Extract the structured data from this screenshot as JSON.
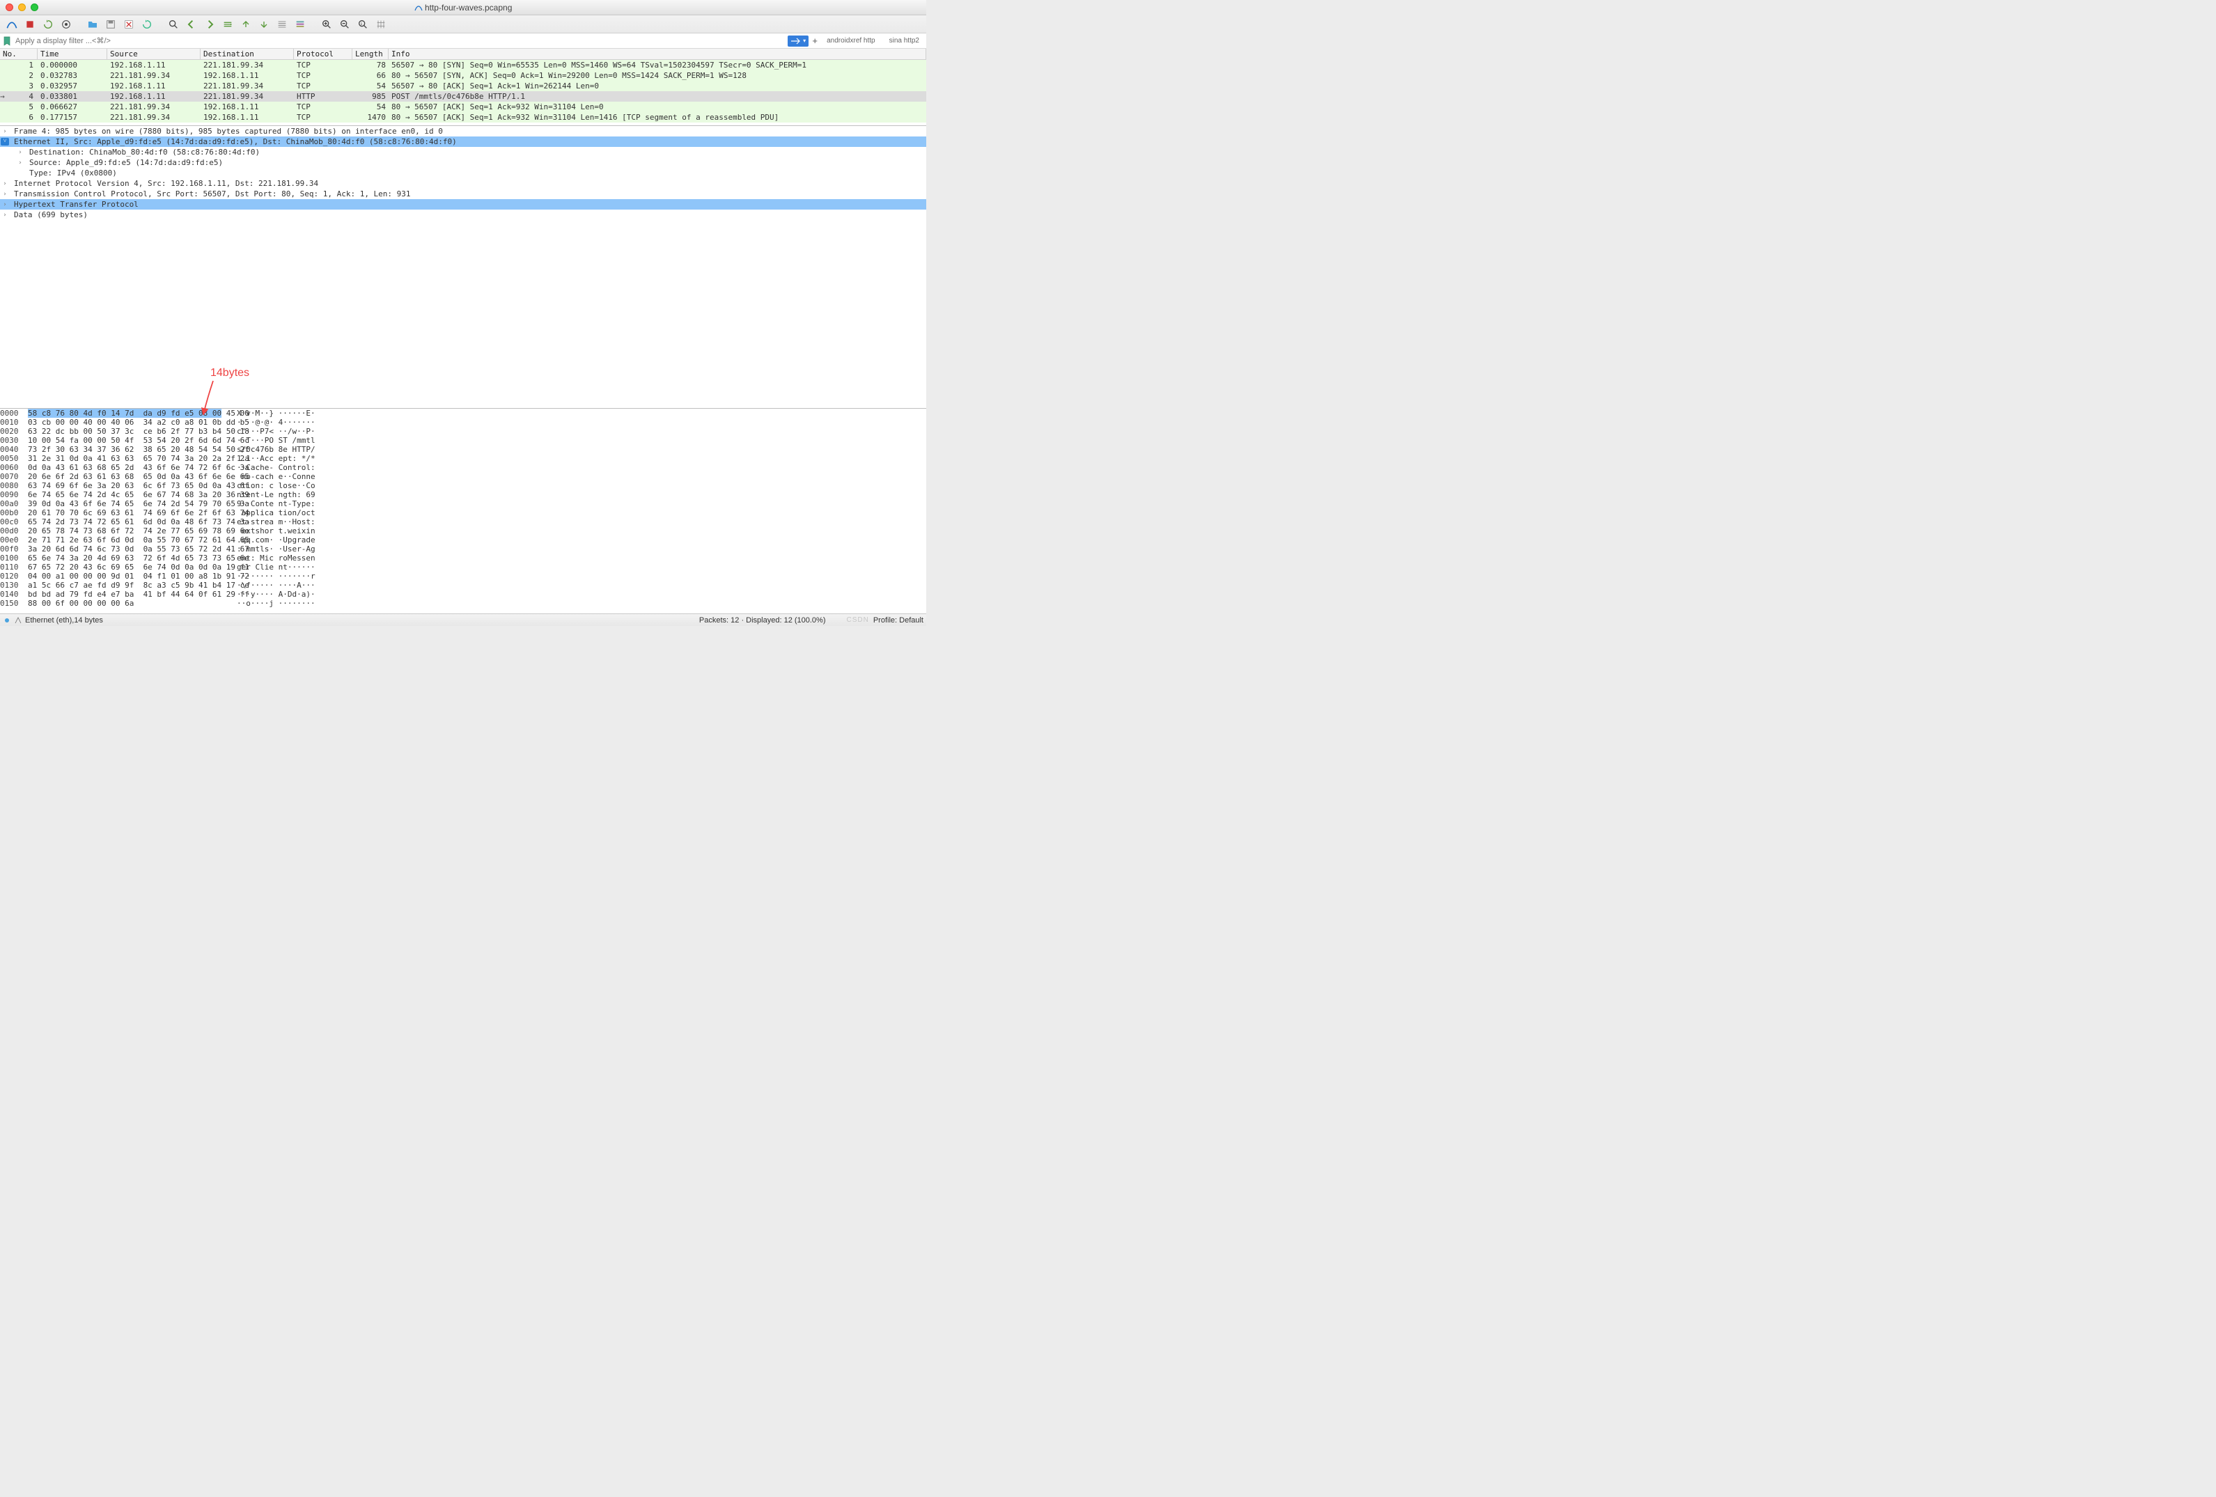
{
  "window": {
    "title": "http-four-waves.pcapng"
  },
  "annotation": {
    "label": "14bytes"
  },
  "filter": {
    "placeholder": "Apply a display filter ...<⌘/>",
    "shortcuts": [
      {
        "label": "androidxref http"
      },
      {
        "label": "sina http2"
      }
    ]
  },
  "columns": {
    "no": "No.",
    "time": "Time",
    "source": "Source",
    "destination": "Destination",
    "protocol": "Protocol",
    "length": "Length",
    "info": "Info"
  },
  "packets": [
    {
      "no": "1",
      "time": "0.000000",
      "src": "192.168.1.11",
      "dst": "221.181.99.34",
      "proto": "TCP",
      "len": "78",
      "info": "56507 → 80 [SYN] Seq=0 Win=65535 Len=0 MSS=1460 WS=64 TSval=1502304597 TSecr=0 SACK_PERM=1",
      "bg": "#e9fbe1"
    },
    {
      "no": "2",
      "time": "0.032783",
      "src": "221.181.99.34",
      "dst": "192.168.1.11",
      "proto": "TCP",
      "len": "66",
      "info": "80 → 56507 [SYN, ACK] Seq=0 Ack=1 Win=29200 Len=0 MSS=1424 SACK_PERM=1 WS=128",
      "bg": "#e9fbe1"
    },
    {
      "no": "3",
      "time": "0.032957",
      "src": "192.168.1.11",
      "dst": "221.181.99.34",
      "proto": "TCP",
      "len": "54",
      "info": "56507 → 80 [ACK] Seq=1 Ack=1 Win=262144 Len=0",
      "bg": "#e9fbe1"
    },
    {
      "no": "4",
      "time": "0.033801",
      "src": "192.168.1.11",
      "dst": "221.181.99.34",
      "proto": "HTTP",
      "len": "985",
      "info": "POST /mmtls/0c476b8e HTTP/1.1",
      "bg": "#e0ffe0",
      "selected": true,
      "arrow": true
    },
    {
      "no": "5",
      "time": "0.066627",
      "src": "221.181.99.34",
      "dst": "192.168.1.11",
      "proto": "TCP",
      "len": "54",
      "info": "80 → 56507 [ACK] Seq=1 Ack=932 Win=31104 Len=0",
      "bg": "#e9fbe1"
    },
    {
      "no": "6",
      "time": "0.177157",
      "src": "221.181.99.34",
      "dst": "192.168.1.11",
      "proto": "TCP",
      "len": "1470",
      "info": "80 → 56507 [ACK] Seq=1 Ack=932 Win=31104 Len=1416 [TCP segment of a reassembled PDU]",
      "bg": "#e9fbe1"
    }
  ],
  "details": [
    {
      "text": "Frame 4: 985 bytes on wire (7880 bits), 985 bytes captured (7880 bits) on interface en0, id 0",
      "twisty": ">",
      "lvl": 0,
      "sel": false
    },
    {
      "text": "Ethernet II, Src: Apple_d9:fd:e5 (14:7d:da:d9:fd:e5), Dst: ChinaMob_80:4d:f0 (58:c8:76:80:4d:f0)",
      "twisty": "v",
      "lvl": 0,
      "sel": true,
      "open": true
    },
    {
      "text": "Destination: ChinaMob_80:4d:f0 (58:c8:76:80:4d:f0)",
      "twisty": ">",
      "lvl": 1
    },
    {
      "text": "Source: Apple_d9:fd:e5 (14:7d:da:d9:fd:e5)",
      "twisty": ">",
      "lvl": 1
    },
    {
      "text": "Type: IPv4 (0x0800)",
      "twisty": "",
      "lvl": 1
    },
    {
      "text": "Internet Protocol Version 4, Src: 192.168.1.11, Dst: 221.181.99.34",
      "twisty": ">",
      "lvl": 0
    },
    {
      "text": "Transmission Control Protocol, Src Port: 56507, Dst Port: 80, Seq: 1, Ack: 1, Len: 931",
      "twisty": ">",
      "lvl": 0
    },
    {
      "text": "Hypertext Transfer Protocol",
      "twisty": ">",
      "lvl": 0,
      "sel2": true
    },
    {
      "text": "Data (699 bytes)",
      "twisty": ">",
      "lvl": 0
    }
  ],
  "hex": [
    {
      "off": "0000",
      "b1": "58 c8 76 80 4d f0 14 7d",
      "b2": "da d9 fd e5 08 00",
      "b2tail": " 45 00",
      "a": "X·v·M··} ······E·",
      "hi": true
    },
    {
      "off": "0010",
      "b1": "03 cb 00 00 40 00 40 06",
      "b2": "34 a2 c0 a8 01 0b dd b5",
      "a": "····@·@· 4·······"
    },
    {
      "off": "0020",
      "b1": "63 22 dc bb 00 50 37 3c",
      "b2": "ce b6 2f 77 b3 b4 50 18",
      "a": "c\"···P7< ··/w··P·"
    },
    {
      "off": "0030",
      "b1": "10 00 54 fa 00 00 50 4f",
      "b2": "53 54 20 2f 6d 6d 74 6c",
      "a": "··T···PO ST /mmtl"
    },
    {
      "off": "0040",
      "b1": "73 2f 30 63 34 37 36 62",
      "b2": "38 65 20 48 54 54 50 2f",
      "a": "s/0c476b 8e HTTP/"
    },
    {
      "off": "0050",
      "b1": "31 2e 31 0d 0a 41 63 63",
      "b2": "65 70 74 3a 20 2a 2f 2a",
      "a": "1.1··Acc ept: */*"
    },
    {
      "off": "0060",
      "b1": "0d 0a 43 61 63 68 65 2d",
      "b2": "43 6f 6e 74 72 6f 6c 3a",
      "a": "··Cache- Control:"
    },
    {
      "off": "0070",
      "b1": "20 6e 6f 2d 63 61 63 68",
      "b2": "65 0d 0a 43 6f 6e 6e 65",
      "a": " no-cach e··Conne"
    },
    {
      "off": "0080",
      "b1": "63 74 69 6f 6e 3a 20 63",
      "b2": "6c 6f 73 65 0d 0a 43 6f",
      "a": "ction: c lose··Co"
    },
    {
      "off": "0090",
      "b1": "6e 74 65 6e 74 2d 4c 65",
      "b2": "6e 67 74 68 3a 20 36 39",
      "a": "ntent-Le ngth: 69"
    },
    {
      "off": "00a0",
      "b1": "39 0d 0a 43 6f 6e 74 65",
      "b2": "6e 74 2d 54 79 70 65 3a",
      "a": "9··Conte nt-Type:"
    },
    {
      "off": "00b0",
      "b1": "20 61 70 70 6c 69 63 61",
      "b2": "74 69 6f 6e 2f 6f 63 74",
      "a": " applica tion/oct"
    },
    {
      "off": "00c0",
      "b1": "65 74 2d 73 74 72 65 61",
      "b2": "6d 0d 0a 48 6f 73 74 3a",
      "a": "et-strea m··Host:"
    },
    {
      "off": "00d0",
      "b1": "20 65 78 74 73 68 6f 72",
      "b2": "74 2e 77 65 69 78 69 6e",
      "a": " extshor t.weixin"
    },
    {
      "off": "00e0",
      "b1": "2e 71 71 2e 63 6f 6d 0d",
      "b2": "0a 55 70 67 72 61 64 65",
      "a": ".qq.com· ·Upgrade"
    },
    {
      "off": "00f0",
      "b1": "3a 20 6d 6d 74 6c 73 0d",
      "b2": "0a 55 73 65 72 2d 41 67",
      "a": ": mmtls· ·User-Ag"
    },
    {
      "off": "0100",
      "b1": "65 6e 74 3a 20 4d 69 63",
      "b2": "72 6f 4d 65 73 73 65 6e",
      "a": "ent: Mic roMessen"
    },
    {
      "off": "0110",
      "b1": "67 65 72 20 43 6c 69 65",
      "b2": "6e 74 0d 0a 0d 0a 19 f1",
      "a": "ger Clie nt······"
    },
    {
      "off": "0120",
      "b1": "04 00 a1 00 00 00 9d 01",
      "b2": "04 f1 01 00 a8 1b 91 72",
      "a": "········ ·······r"
    },
    {
      "off": "0130",
      "b1": "a1 5c 66 c7 ae fd d9 9f",
      "b2": "8c a3 c5 9b 41 b4 17 ce",
      "a": "·\\f····· ····A···"
    },
    {
      "off": "0140",
      "b1": "bd bd ad 79 fd e4 e7 ba",
      "b2": "41 bf 44 64 0f 61 29 ff",
      "a": "···y···· A·Dd·a)·"
    },
    {
      "off": "0150",
      "b1": "88 00 6f 00 00 00 00 6a",
      "b2": "             ",
      "a": "··o····j ········"
    }
  ],
  "status": {
    "left": "Ethernet (eth),14 bytes",
    "packets": "Packets: 12 · Displayed: 12 (100.0%)",
    "profile": "Profile: Default",
    "watermark": "CSDN"
  }
}
